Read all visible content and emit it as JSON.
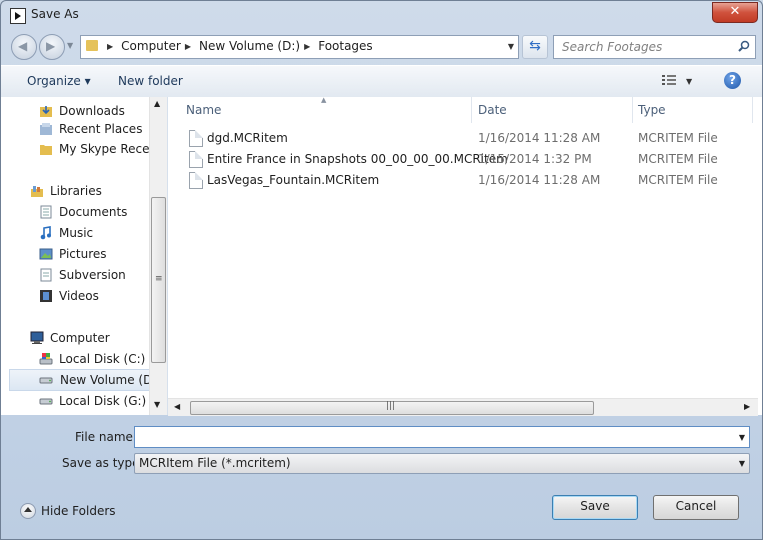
{
  "window": {
    "title": "Save As",
    "close_glyph": "✕"
  },
  "nav": {
    "back_icon": "back-arrow-icon",
    "forward_icon": "forward-arrow-icon",
    "breadcrumbs": [
      "Computer",
      "New Volume (D:)",
      "Footages"
    ],
    "search_placeholder": "Search Footages"
  },
  "toolbar": {
    "organize_label": "Organize ▾",
    "new_folder_label": "New folder",
    "help_label": "?"
  },
  "sidebar": {
    "items": [
      {
        "label": "Downloads",
        "icon": "downloads-folder-icon"
      },
      {
        "label": "Recent Places",
        "icon": "recent-places-icon"
      },
      {
        "label": "My Skype Received Files",
        "icon": "folder-icon"
      },
      {
        "label": "Libraries",
        "icon": "libraries-icon"
      },
      {
        "label": "Documents",
        "icon": "documents-icon"
      },
      {
        "label": "Music",
        "icon": "music-icon"
      },
      {
        "label": "Pictures",
        "icon": "pictures-icon"
      },
      {
        "label": "Subversion",
        "icon": "document-icon"
      },
      {
        "label": "Videos",
        "icon": "videos-icon"
      },
      {
        "label": "Computer",
        "icon": "computer-icon"
      },
      {
        "label": "Local Disk (C:)",
        "icon": "local-disk-icon"
      },
      {
        "label": "New Volume (D:)",
        "icon": "drive-icon",
        "selected": true
      },
      {
        "label": "Local Disk (G:)",
        "icon": "drive-icon"
      }
    ]
  },
  "files": {
    "columns": [
      "Name",
      "Date",
      "Type"
    ],
    "rows": [
      {
        "name": "dgd.MCRitem",
        "date": "1/16/2014 11:28 AM",
        "type": "MCRITEM File"
      },
      {
        "name": "Entire France in Snapshots 00_00_00_00.MCRitem",
        "date": "1/15/2014 1:32 PM",
        "type": "MCRITEM File"
      },
      {
        "name": "LasVegas_Fountain.MCRitem",
        "date": "1/16/2014 11:28 AM",
        "type": "MCRITEM File"
      }
    ]
  },
  "form": {
    "file_name_label": "File name:",
    "file_name_value": "",
    "save_type_label": "Save as type:",
    "save_type_value": "MCRItem File (*.mcritem)"
  },
  "footer": {
    "hide_folders_label": "Hide Folders",
    "save_label": "Save",
    "cancel_label": "Cancel"
  }
}
